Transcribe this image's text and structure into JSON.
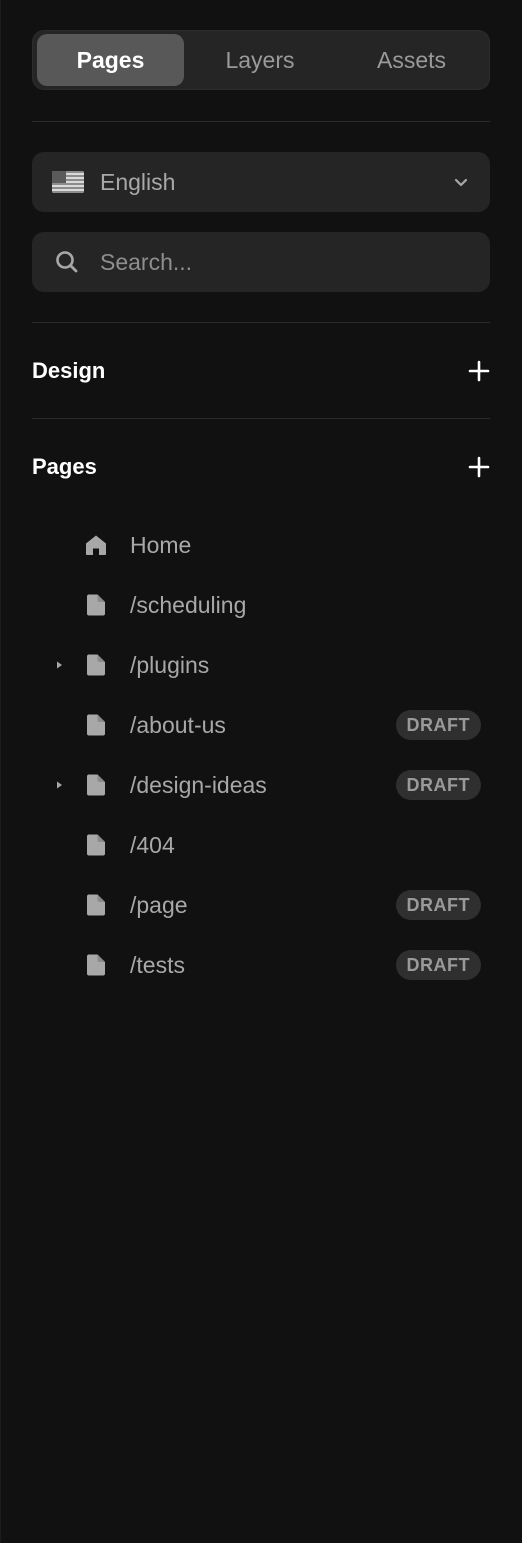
{
  "tabs": [
    {
      "label": "Pages",
      "active": true
    },
    {
      "label": "Layers",
      "active": false
    },
    {
      "label": "Assets",
      "active": false
    }
  ],
  "locale": {
    "label": "English",
    "flag_icon": "us-flag-icon",
    "chevron_icon": "chevron-down-icon"
  },
  "search": {
    "placeholder": "Search...",
    "value": ""
  },
  "sections": {
    "design": {
      "title": "Design"
    },
    "pages": {
      "title": "Pages"
    }
  },
  "pages": [
    {
      "label": "Home",
      "icon": "home-icon",
      "expandable": false,
      "badge": ""
    },
    {
      "label": "/scheduling",
      "icon": "page-icon",
      "expandable": false,
      "badge": ""
    },
    {
      "label": "/plugins",
      "icon": "page-icon",
      "expandable": true,
      "badge": ""
    },
    {
      "label": "/about-us",
      "icon": "page-icon",
      "expandable": false,
      "badge": "DRAFT"
    },
    {
      "label": "/design-ideas",
      "icon": "page-icon",
      "expandable": true,
      "badge": "DRAFT"
    },
    {
      "label": "/404",
      "icon": "page-icon",
      "expandable": false,
      "badge": ""
    },
    {
      "label": "/page",
      "icon": "page-icon",
      "expandable": false,
      "badge": "DRAFT"
    },
    {
      "label": "/tests",
      "icon": "page-icon",
      "expandable": false,
      "badge": "DRAFT"
    }
  ],
  "colors": {
    "background": "#111111",
    "surface": "#252525",
    "active_tab": "#585858",
    "text_primary": "#ffffff",
    "text_secondary": "#a8a8a8",
    "badge_bg": "#2f2f2f"
  }
}
